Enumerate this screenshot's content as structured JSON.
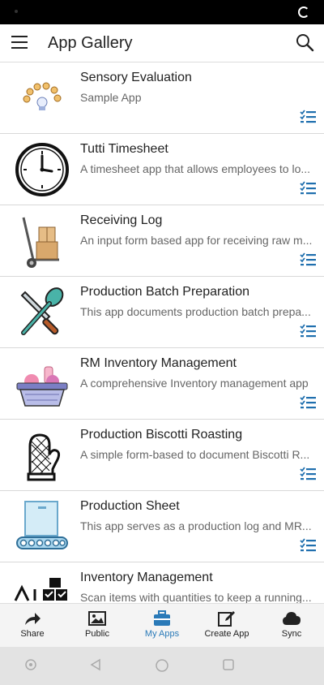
{
  "header": {
    "title": "App Gallery",
    "menu_icon": "hamburger-menu-icon",
    "search_icon": "search-icon"
  },
  "apps": [
    {
      "name": "Sensory Evaluation",
      "description": "Sample App",
      "icon": "sensory-evaluation-icon"
    },
    {
      "name": "Tutti Timesheet",
      "description": "A timesheet app that allows employees to lo...",
      "icon": "clock-icon"
    },
    {
      "name": "Receiving Log",
      "description": "An input form based app for receiving raw m...",
      "icon": "hand-truck-icon"
    },
    {
      "name": "Production Batch Preparation",
      "description": "This app documents production batch prepa...",
      "icon": "knife-spatula-icon"
    },
    {
      "name": "RM Inventory Management",
      "description": "A comprehensive Inventory management app",
      "icon": "basket-icon"
    },
    {
      "name": "Production Biscotti Roasting",
      "description": "A simple form-based to document Biscotti R...",
      "icon": "oven-mitt-icon"
    },
    {
      "name": "Production Sheet",
      "description": "This app serves as a production log and MR...",
      "icon": "conveyor-icon"
    },
    {
      "name": "Inventory Management",
      "description": "Scan items with quantities to keep a running...",
      "icon": "boxes-icon"
    }
  ],
  "bottom_nav": [
    {
      "label": "Share",
      "icon": "share-icon",
      "active": false
    },
    {
      "label": "Public",
      "icon": "image-icon",
      "active": false
    },
    {
      "label": "My Apps",
      "icon": "briefcase-icon",
      "active": true
    },
    {
      "label": "Create App",
      "icon": "edit-icon",
      "active": false
    },
    {
      "label": "Sync",
      "icon": "cloud-icon",
      "active": false
    }
  ],
  "colors": {
    "accent": "#2a7ab8",
    "list_icon": "#1f6fae"
  }
}
